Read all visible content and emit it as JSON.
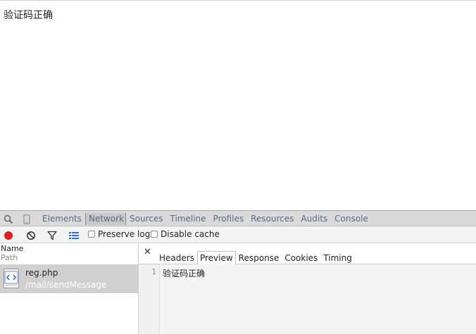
{
  "page": {
    "message": "验证码正确"
  },
  "devtools": {
    "tabs": [
      "Elements",
      "Network",
      "Sources",
      "Timeline",
      "Profiles",
      "Resources",
      "Audits",
      "Console"
    ],
    "active_tab": "Network",
    "icons": {
      "inspect": "magnifier-icon",
      "device": "mobile-device-icon"
    },
    "network_toolbar": {
      "icons": [
        "record-icon",
        "clear-icon",
        "filter-icon",
        "list-view-icon"
      ],
      "preserve_log": "Preserve log",
      "disable_cache": "Disable cache"
    },
    "request_list": {
      "col_name": "Name",
      "col_path": "Path",
      "requests": [
        {
          "name": "reg.php",
          "path": "/mail/sendMessage"
        }
      ]
    },
    "detail": {
      "tabs": [
        "Headers",
        "Preview",
        "Response",
        "Cookies",
        "Timing"
      ],
      "active_tab": "Preview",
      "preview_lines": [
        {
          "num": "1",
          "text": "验证码正确"
        }
      ]
    }
  },
  "colors": {
    "record": "#e21c1c",
    "tab_text": "#5a6a86",
    "selected_row": "#d0d0d0"
  }
}
